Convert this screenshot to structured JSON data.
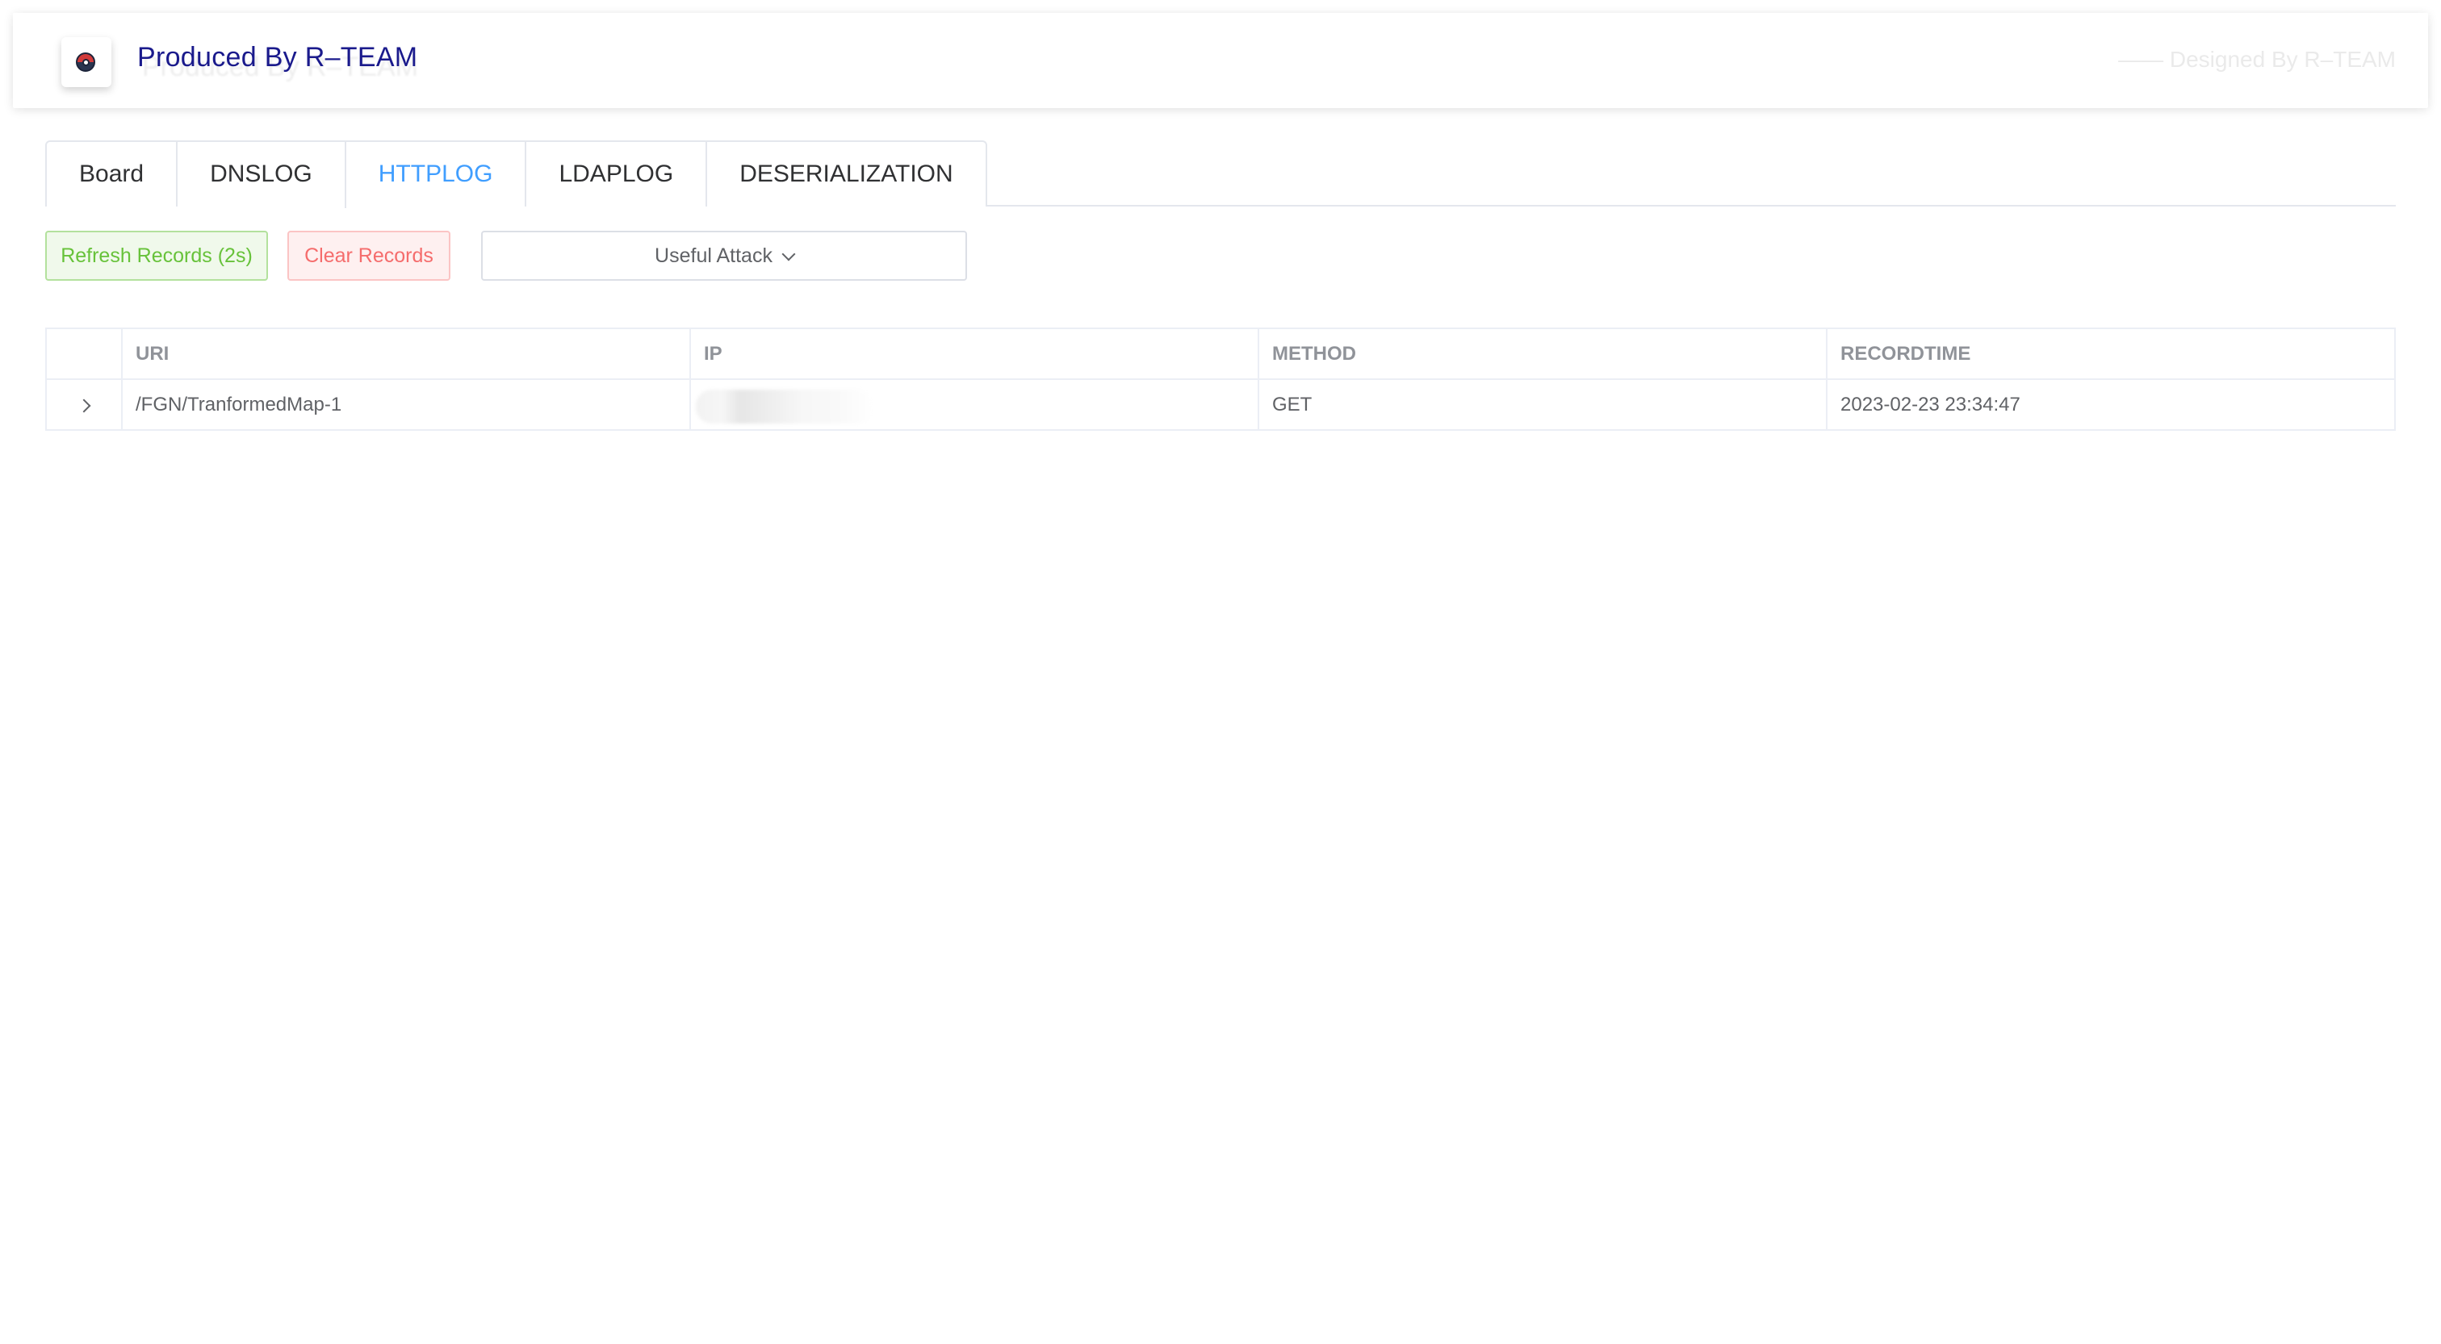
{
  "header": {
    "logo_icon": "pokeball-icon",
    "title": "Produced By R–TEAM",
    "designed_by": "—— Designed By R–TEAM"
  },
  "tabs": [
    {
      "label": "Board",
      "active": false
    },
    {
      "label": "DNSLOG",
      "active": false
    },
    {
      "label": "HTTPLOG",
      "active": true
    },
    {
      "label": "LDAPLOG",
      "active": false
    },
    {
      "label": "DESERIALIZATION",
      "active": false
    }
  ],
  "toolbar": {
    "refresh_label": "Refresh Records (2s)",
    "clear_label": "Clear Records",
    "attack_label": "Useful Attack"
  },
  "table": {
    "columns": [
      "URI",
      "IP",
      "METHOD",
      "RECORDTIME"
    ],
    "rows": [
      {
        "uri": "/FGN/TranformedMap-1",
        "ip": "",
        "method": "GET",
        "recordtime": "2023-02-23 23:34:47"
      }
    ]
  },
  "colors": {
    "brand_title": "#1a1a8c",
    "tab_active": "#409eff",
    "success": "#67c23a",
    "danger": "#f56c6c"
  }
}
